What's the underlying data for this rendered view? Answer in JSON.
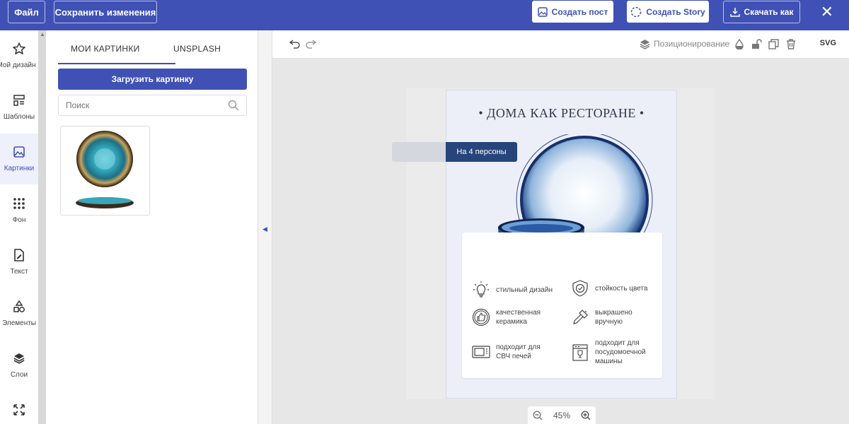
{
  "topbar": {
    "file_label": "Файл",
    "save_label": "Сохранить изменения",
    "create_post_label": "Создать пост",
    "create_story_label": "Создать Story",
    "download_label": "Скачать как",
    "close_label": "✕"
  },
  "rail": {
    "items": [
      {
        "label": "Мой дизайн",
        "icon": "star-icon"
      },
      {
        "label": "Шаблоны",
        "icon": "templates-icon"
      },
      {
        "label": "Картинки",
        "icon": "image-icon"
      },
      {
        "label": "Фон",
        "icon": "grid-dots-icon"
      },
      {
        "label": "Текст",
        "icon": "text-edit-icon"
      },
      {
        "label": "Элементы",
        "icon": "shapes-icon"
      },
      {
        "label": "Слои",
        "icon": "layers-icon"
      },
      {
        "label": "",
        "icon": "expand-icon"
      }
    ]
  },
  "panel": {
    "tabs": [
      "МОИ КАРТИНКИ",
      "UNSPLASH"
    ],
    "upload_label": "Загрузить картинку",
    "search_placeholder": "Поиск"
  },
  "toolbar": {
    "positioning_label": "Позиционирование",
    "svg_label": "SVG"
  },
  "design": {
    "title": "• ДОМА КАК РЕСТОРАНЕ •",
    "badge": "На 4 персоны",
    "features": [
      {
        "text": "стильный дизайн",
        "icon": "lightbulb-icon"
      },
      {
        "text": "стойкость цвета",
        "icon": "shield-check-icon"
      },
      {
        "text": "качественная\nкерамика",
        "icon": "thumbs-up-icon"
      },
      {
        "text": "выкрашено\nвручную",
        "icon": "paintbrush-icon"
      },
      {
        "text": "подходит для\nСВЧ печей",
        "icon": "microwave-icon"
      },
      {
        "text": "подходит для\nпосудомоечной\nмашины",
        "icon": "dishwasher-icon"
      }
    ]
  },
  "zoom": {
    "level": "45%"
  },
  "colors": {
    "accent": "#3f51b5",
    "badge": "#27457a",
    "canvas_bg": "#edeff8"
  }
}
